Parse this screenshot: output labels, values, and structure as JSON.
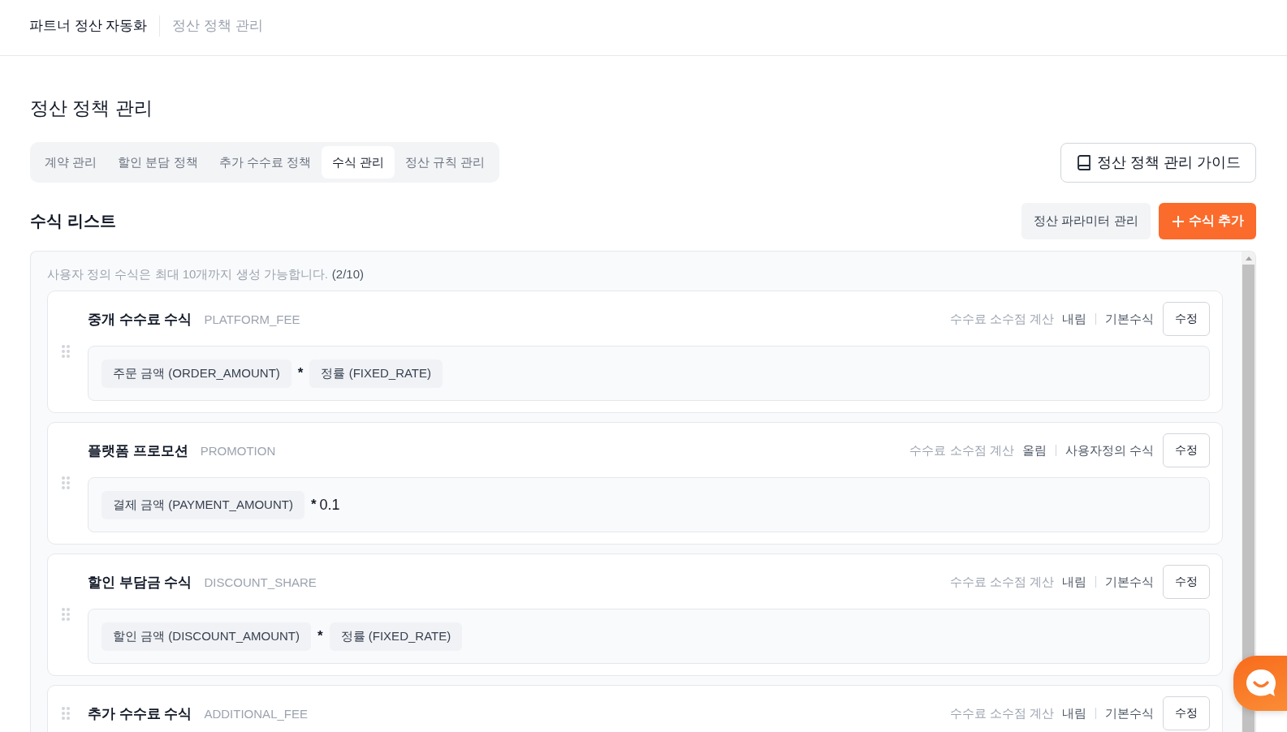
{
  "header": {
    "app_title": "파트너 정산 자동화",
    "current_page": "정산 정책 관리"
  },
  "page_title": "정산 정책 관리",
  "tabs": [
    {
      "label": "계약 관리",
      "selected": false
    },
    {
      "label": "할인 분담 정책",
      "selected": false
    },
    {
      "label": "추가 수수료 정책",
      "selected": false
    },
    {
      "label": "수식 관리",
      "selected": true
    },
    {
      "label": "정산 규칙 관리",
      "selected": false
    }
  ],
  "guide_button": {
    "label": "정산 정책 관리 가이드"
  },
  "section": {
    "title": "수식 리스트",
    "parameter_button": {
      "label": "정산 파라미터 관리"
    },
    "add_button": {
      "label": "수식 추가"
    }
  },
  "formula_list": {
    "note": "사용자 정의 수식은 최대 10개까지 생성 가능합니다.",
    "count": "(2/10)",
    "formulas": [
      {
        "name": "중개 수수료 수식",
        "code": "PLATFORM_FEE",
        "rounding_label": "수수료 소수점 계산",
        "rounding": "내림",
        "type": "기본수식",
        "edit_label": "수정",
        "tokens": [
          {
            "kind": "parameter",
            "text": "주문 금액 (ORDER_AMOUNT)"
          },
          {
            "kind": "operator",
            "text": "*"
          },
          {
            "kind": "parameter",
            "text": "정률 (FIXED_RATE)"
          }
        ]
      },
      {
        "name": "플랫폼 프로모션",
        "code": "PROMOTION",
        "rounding_label": "수수료 소수점 계산",
        "rounding": "올림",
        "type": "사용자정의 수식",
        "edit_label": "수정",
        "tokens": [
          {
            "kind": "parameter",
            "text": "결제 금액 (PAYMENT_AMOUNT)"
          },
          {
            "kind": "operator",
            "text": "*"
          },
          {
            "kind": "constant",
            "text": "0.1"
          }
        ]
      },
      {
        "name": "할인 부담금 수식",
        "code": "DISCOUNT_SHARE",
        "rounding_label": "수수료 소수점 계산",
        "rounding": "내림",
        "type": "기본수식",
        "edit_label": "수정",
        "tokens": [
          {
            "kind": "parameter",
            "text": "할인 금액 (DISCOUNT_AMOUNT)"
          },
          {
            "kind": "operator",
            "text": "*"
          },
          {
            "kind": "parameter",
            "text": "정률 (FIXED_RATE)"
          }
        ]
      },
      {
        "name": "추가 수수료 수식",
        "code": "ADDITIONAL_FEE",
        "rounding_label": "수수료 소수점 계산",
        "rounding": "내림",
        "type": "기본수식",
        "edit_label": "수정"
      }
    ]
  }
}
